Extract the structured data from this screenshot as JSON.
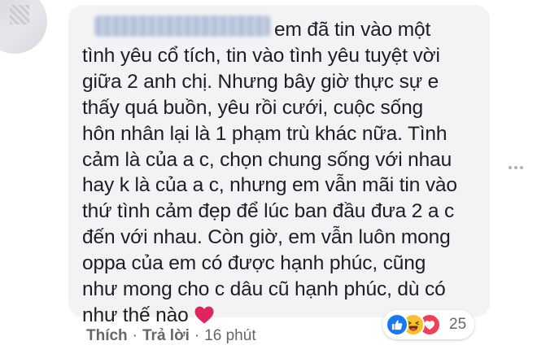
{
  "comment": {
    "lines": [
      "em đã tin vào một",
      "tình yêu cổ tích, tin vào tình yêu tuyệt vời",
      "giữa 2 anh chị. Nhưng bây giờ thực sự e",
      "thấy quá buồn, yêu rồi cưới, cuộc sống",
      "hôn nhân lại là 1 phạm trù khác nữa. Tình",
      "cảm là của a c, chọn chung sống với nhau",
      "hay k là của a c, nhưng em vẫn mãi tin vào",
      "thứ tình cảm đẹp để lúc ban đầu đưa 2 a c",
      "đến với nhau. Còn giờ, em vẫn luôn mong",
      "oppa của em có được hạnh phúc, cũng",
      "như mong cho c dâu cũ hạnh phúc, dù có",
      "như thế nào"
    ],
    "trailing_emoji": "heart-emoji",
    "text_color": "#1c1e21",
    "bubble_color": "#f2f3f5"
  },
  "reactions": {
    "icons": [
      "like-icon",
      "haha-icon",
      "love-icon"
    ],
    "count": "25",
    "colors": {
      "like": "#1877f2",
      "haha": "#f7c12d",
      "love": "#f33e58"
    }
  },
  "actions": {
    "like_label": "Thích",
    "separator": "·",
    "reply_label": "Trả lời",
    "timestamp": "16 phút"
  },
  "more_options_icon": "more-horizontal-icon",
  "heart_color": "#e0245e"
}
